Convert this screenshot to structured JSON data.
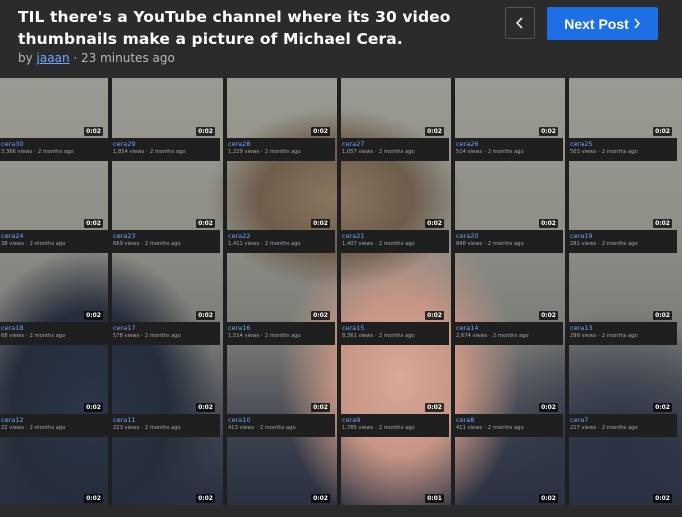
{
  "post": {
    "title": "TIL there's a YouTube channel where its 30 video thumbnails make a picture of Michael Cera.",
    "by_prefix": "by",
    "author": "jaaan",
    "separator": "·",
    "time": "23 minutes ago"
  },
  "nav": {
    "prev_icon": "chevron-left-icon",
    "next_label": "Next Post",
    "next_icon": "chevron-right-icon",
    "accent_color": "#1e6fe6"
  },
  "videos": [
    {
      "name": "cera30",
      "views": "3,366 views",
      "age": "2 months ago",
      "duration": "0:02"
    },
    {
      "name": "cera29",
      "views": "1,854 views",
      "age": "2 months ago",
      "duration": "0:02"
    },
    {
      "name": "cera28",
      "views": "1,229 views",
      "age": "2 months ago",
      "duration": "0:02"
    },
    {
      "name": "cera27",
      "views": "1,057 views",
      "age": "2 months ago",
      "duration": "0:02"
    },
    {
      "name": "cera26",
      "views": "514 views",
      "age": "2 months ago",
      "duration": "0:02"
    },
    {
      "name": "cera25",
      "views": "503 views",
      "age": "2 months ago",
      "duration": "0:02"
    },
    {
      "name": "cera24",
      "views": "38 views",
      "age": "2 months ago",
      "duration": "0:02"
    },
    {
      "name": "cera23",
      "views": "669 views",
      "age": "2 months ago",
      "duration": "0:02"
    },
    {
      "name": "cera22",
      "views": "1,411 views",
      "age": "2 months ago",
      "duration": "0:02"
    },
    {
      "name": "cera21",
      "views": "1,407 views",
      "age": "2 months ago",
      "duration": "0:02"
    },
    {
      "name": "cera20",
      "views": "848 views",
      "age": "2 months ago",
      "duration": "0:02"
    },
    {
      "name": "cera19",
      "views": "281 views",
      "age": "2 months ago",
      "duration": "0:02"
    },
    {
      "name": "cera18",
      "views": "68 views",
      "age": "2 months ago",
      "duration": "0:02"
    },
    {
      "name": "cera17",
      "views": "578 views",
      "age": "2 months ago",
      "duration": "0:02"
    },
    {
      "name": "cera16",
      "views": "1,514 views",
      "age": "2 months ago",
      "duration": "0:02"
    },
    {
      "name": "cera15",
      "views": "8,361 views",
      "age": "2 months ago",
      "duration": "0:02"
    },
    {
      "name": "cera14",
      "views": "2,674 views",
      "age": "2 months ago",
      "duration": "0:02"
    },
    {
      "name": "cera13",
      "views": "299 views",
      "age": "2 months ago",
      "duration": "0:02"
    },
    {
      "name": "cera12",
      "views": "22 views",
      "age": "2 months ago",
      "duration": "0:02"
    },
    {
      "name": "cera11",
      "views": "223 views",
      "age": "2 months ago",
      "duration": "0:02"
    },
    {
      "name": "cera10",
      "views": "413 views",
      "age": "2 months ago",
      "duration": "0:02"
    },
    {
      "name": "cera9",
      "views": "1,785 views",
      "age": "2 months ago",
      "duration": "0:02"
    },
    {
      "name": "cera8",
      "views": "411 views",
      "age": "2 months ago",
      "duration": "0:02"
    },
    {
      "name": "cera7",
      "views": "217 views",
      "age": "2 months ago",
      "duration": "0:02"
    },
    {
      "name": "",
      "views": "",
      "age": "",
      "duration": "0:02"
    },
    {
      "name": "",
      "views": "",
      "age": "",
      "duration": "0:02"
    },
    {
      "name": "",
      "views": "",
      "age": "",
      "duration": "0:02"
    },
    {
      "name": "",
      "views": "",
      "age": "",
      "duration": "0:01"
    },
    {
      "name": "",
      "views": "",
      "age": "",
      "duration": "0:02"
    },
    {
      "name": "",
      "views": "",
      "age": "",
      "duration": "0:02"
    }
  ]
}
